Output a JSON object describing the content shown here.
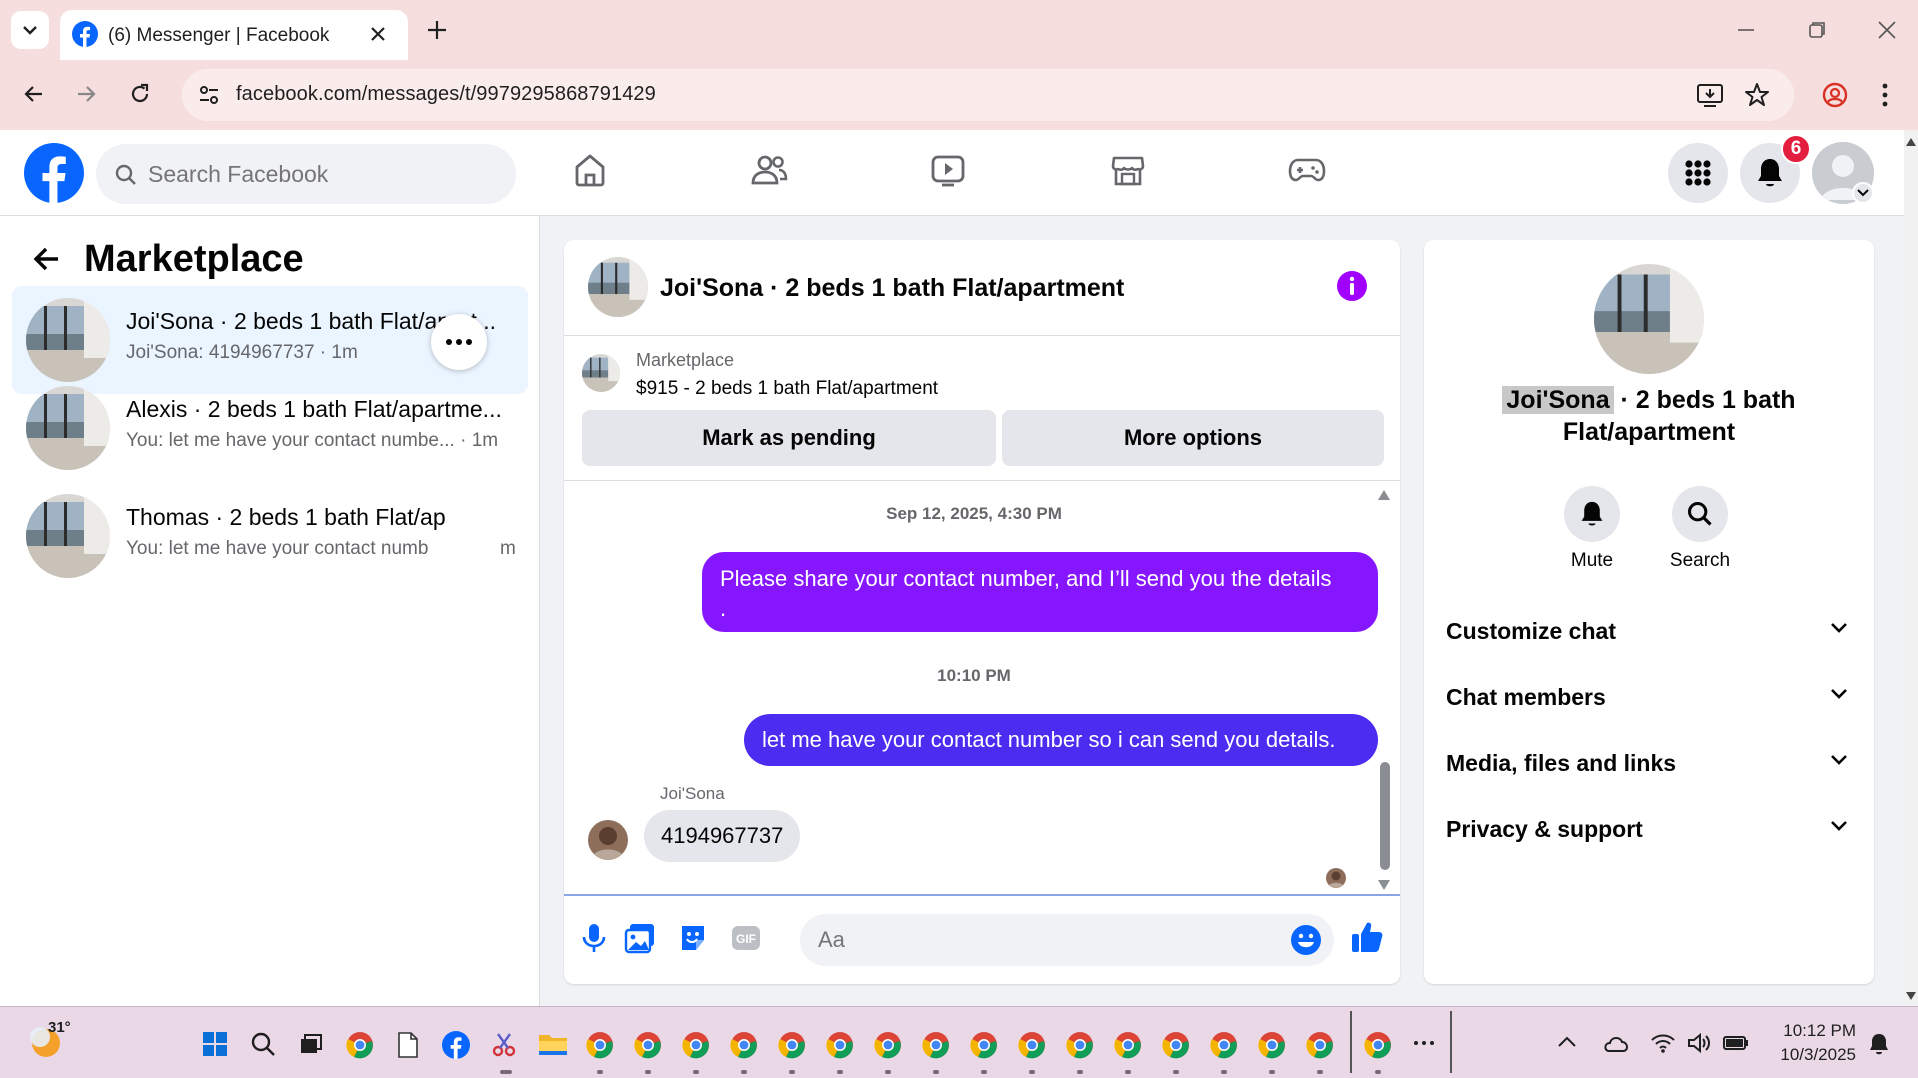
{
  "browser": {
    "tab_title": "(6) Messenger | Facebook",
    "url": "facebook.com/messages/t/9979295868791429"
  },
  "fb": {
    "search_placeholder": "Search Facebook",
    "notification_count": "6",
    "brand_color": "#0866ff"
  },
  "left": {
    "title": "Marketplace",
    "conversations": [
      {
        "title": "Joi'Sona · 2 beds 1 bath Flat/apart...",
        "subtitle": "Joi'Sona: 4194967737 · 1m",
        "active": true
      },
      {
        "title": "Alexis · 2 beds 1 bath Flat/apartme...",
        "subtitle": "You: let me have your contact numbe... · 1m",
        "active": false
      },
      {
        "title": "Thomas · 2 beds 1 bath Flat/ap",
        "subtitle": "You: let me have your contact numb",
        "subtitle_tail": "m",
        "active": false
      }
    ]
  },
  "chat": {
    "header_title": "Joi'Sona · 2 beds 1 bath Flat/apartment",
    "marketplace_label": "Marketplace",
    "listing": "$915 - 2 beds 1 bath Flat/apartment",
    "btn_pending": "Mark as pending",
    "btn_more": "More options",
    "timestamp1": "Sep 12, 2025, 4:30 PM",
    "message1_line1": "Please share your contact number, and I’ll send you the details",
    "message1_line2": ".",
    "timestamp2": "10:10 PM",
    "message2": "let me have your contact number so i can send you details.",
    "sender_name": "Joi'Sona",
    "message3": "4194967737",
    "composer_placeholder": "Aa",
    "outgoing_color_1": "#8616ff",
    "outgoing_color_2": "#4b2cf0"
  },
  "info": {
    "name": "Joi'Sona",
    "title_rest": " · 2 beds 1 bath Flat/apartment",
    "mute_label": "Mute",
    "search_label": "Search",
    "sections": [
      "Customize chat",
      "Chat members",
      "Media, files and links",
      "Privacy & support"
    ]
  },
  "taskbar": {
    "weather_temp": "31°",
    "time": "10:12 PM",
    "date": "10/3/2025"
  }
}
